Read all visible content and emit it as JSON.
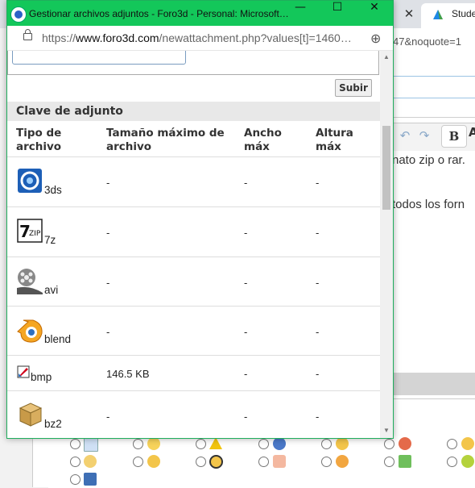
{
  "background": {
    "tab_label": "Stude",
    "url_fragment": "47&noquote=1",
    "text_line1": "nato zip o rar.",
    "text_line2": "todos los forn",
    "bold_label": "B"
  },
  "popup": {
    "window_title": "Gestionar archivos adjuntos - Foro3d - Personal: Microsoft…",
    "url_prefix": "https://",
    "url_host": "www.foro3d.com",
    "url_path": "/newattachment.php?values[t]=1460…",
    "upload_button": "Subir",
    "section_title": "Clave de adjunto",
    "columns": {
      "type": [
        "Tipo de",
        "archivo"
      ],
      "max_size": [
        "Tamaño máximo de",
        "archivo"
      ],
      "max_width": [
        "Ancho",
        "máx"
      ],
      "max_height": [
        "Altura",
        "máx"
      ]
    },
    "rows": [
      {
        "ext": "3ds",
        "size": "-",
        "width": "-",
        "height": "-",
        "icon": "3ds-file-icon"
      },
      {
        "ext": "7z",
        "size": "-",
        "width": "-",
        "height": "-",
        "icon": "7zip-file-icon"
      },
      {
        "ext": "avi",
        "size": "-",
        "width": "-",
        "height": "-",
        "icon": "video-reel-icon"
      },
      {
        "ext": "blend",
        "size": "-",
        "width": "-",
        "height": "-",
        "icon": "blender-icon"
      },
      {
        "ext": "bmp",
        "size": "146.5 KB",
        "width": "-",
        "height": "-",
        "icon": "image-file-icon"
      },
      {
        "ext": "bz2",
        "size": "-",
        "width": "-",
        "height": "-",
        "icon": "archive-box-icon"
      }
    ]
  },
  "colors": {
    "titlebar": "#13c75a",
    "section_header": "#e8e8e8"
  }
}
